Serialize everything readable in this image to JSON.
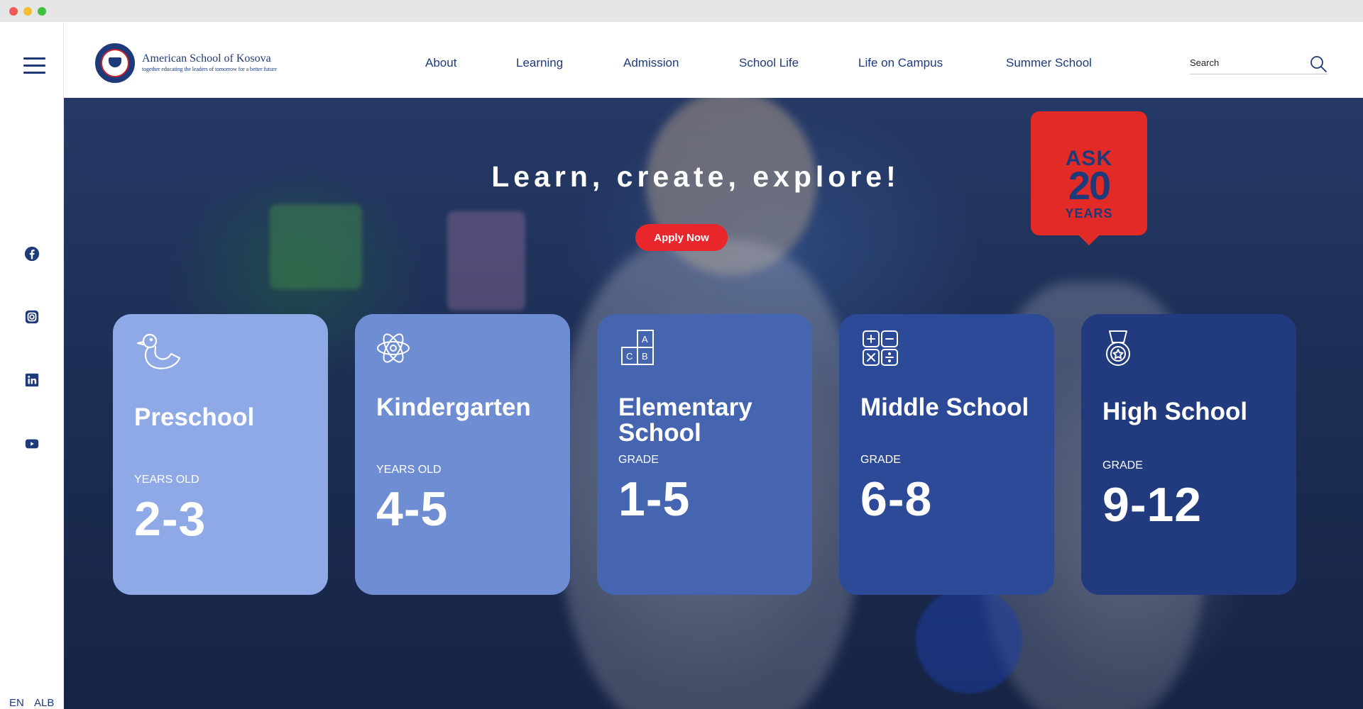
{
  "colors": {
    "brand_navy": "#1e3a7a",
    "accent_red": "#e8262c",
    "card_preschool": "#8fa9e6",
    "card_kindergarten": "#6e8dd2",
    "card_elementary": "#4565b0",
    "card_middle": "#2c4a98",
    "card_high": "#223a7e"
  },
  "sidebar": {
    "menu_icon": "hamburger-icon",
    "social": [
      {
        "name": "facebook-icon"
      },
      {
        "name": "instagram-icon"
      },
      {
        "name": "linkedin-icon"
      },
      {
        "name": "youtube-icon"
      }
    ],
    "languages": [
      "EN",
      "ALB"
    ]
  },
  "header": {
    "logo_name": "American School of Kosova",
    "logo_tagline": "together educating the leaders of tomorrow for a better future",
    "nav": [
      "About",
      "Learning",
      "Admission",
      "School Life",
      "Life on Campus",
      "Summer School"
    ],
    "search_placeholder": "Search",
    "search_icon": "search-icon"
  },
  "hero": {
    "title": "Learn, create, explore!",
    "cta_label": "Apply Now",
    "badge": {
      "line1": "ASK",
      "line2": "20",
      "line3": "YEARS"
    }
  },
  "cards": [
    {
      "title": "Preschool",
      "sub": "YEARS OLD",
      "range": "2-3",
      "icon": "duck-icon"
    },
    {
      "title": "Kindergarten",
      "sub": "YEARS OLD",
      "range": "4-5",
      "icon": "atom-icon"
    },
    {
      "title": "Elementary School",
      "sub": "GRADE",
      "range": "1-5",
      "icon": "abc-blocks-icon"
    },
    {
      "title": "Middle School",
      "sub": "GRADE",
      "range": "6-8",
      "icon": "math-operators-icon"
    },
    {
      "title": "High School",
      "sub": "GRADE",
      "range": "9-12",
      "icon": "medal-icon"
    }
  ]
}
